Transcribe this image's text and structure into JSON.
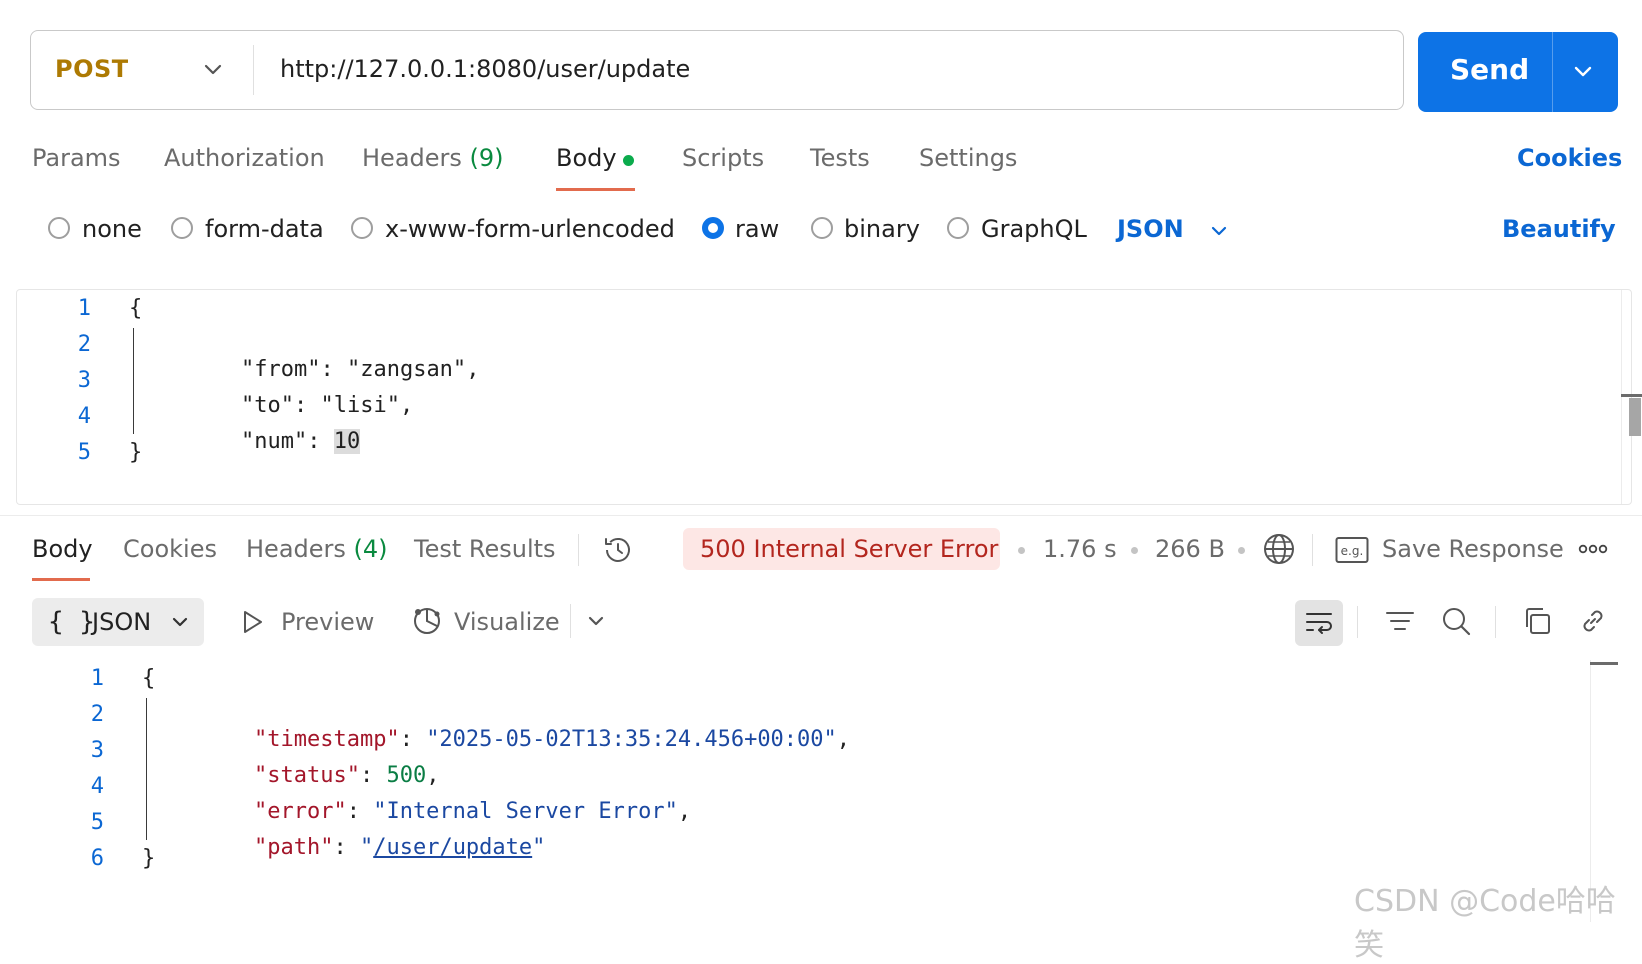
{
  "request": {
    "method": "POST",
    "url": "http://127.0.0.1:8080/user/update",
    "send_label": "Send"
  },
  "request_tabs": [
    {
      "label": "Params"
    },
    {
      "label": "Authorization"
    },
    {
      "label": "Headers",
      "count": "(9)"
    },
    {
      "label": "Body",
      "active": true
    },
    {
      "label": "Scripts"
    },
    {
      "label": "Tests"
    },
    {
      "label": "Settings"
    }
  ],
  "cookies_label": "Cookies",
  "body_types": [
    {
      "label": "none",
      "selected": false
    },
    {
      "label": "form-data",
      "selected": false
    },
    {
      "label": "x-www-form-urlencoded",
      "selected": false
    },
    {
      "label": "raw",
      "selected": true
    },
    {
      "label": "binary",
      "selected": false
    },
    {
      "label": "GraphQL",
      "selected": false
    }
  ],
  "body_format": "JSON",
  "beautify_label": "Beautify",
  "request_body": {
    "line_numbers": [
      "1",
      "2",
      "3",
      "4",
      "5"
    ],
    "open_brace": "{",
    "close_brace": "}",
    "fields": [
      {
        "key": "\"from\"",
        "colon": ": ",
        "value": "\"zangsan\"",
        "trail": ","
      },
      {
        "key": "\"to\"",
        "colon": ": ",
        "value": "\"lisi\"",
        "trail": ","
      },
      {
        "key": "\"num\"",
        "colon": ": ",
        "value": "10",
        "trail": ""
      }
    ]
  },
  "response_tabs": [
    {
      "label": "Body",
      "active": true
    },
    {
      "label": "Cookies"
    },
    {
      "label": "Headers",
      "count": "(4)"
    },
    {
      "label": "Test Results"
    }
  ],
  "response_meta": {
    "status": "500 Internal Server Error",
    "time": "1.76 s",
    "size": "266 B",
    "save_label": "Save Response"
  },
  "response_toolbar": {
    "format_braces": "{ }",
    "format_label": "JSON",
    "preview_label": "Preview",
    "visualize_label": "Visualize"
  },
  "response_body": {
    "line_numbers": [
      "1",
      "2",
      "3",
      "4",
      "5",
      "6"
    ],
    "open_brace": "{",
    "close_brace": "}",
    "fields": [
      {
        "key": "\"timestamp\"",
        "value": "\"2025-05-02T13:35:24.456+00:00\"",
        "trail": ","
      },
      {
        "key": "\"status\"",
        "value": "500",
        "trail": ","
      },
      {
        "key": "\"error\"",
        "value": "\"Internal Server Error\"",
        "trail": ","
      },
      {
        "key": "\"path\"",
        "value_open": "\"",
        "value_link": "/user/update",
        "value_close": "\"",
        "trail": ""
      }
    ]
  },
  "watermark": "CSDN @Code哈哈笑",
  "colors": {
    "accent": "#0d73e6",
    "method": "#ad7a03",
    "error_bg": "#fde7e5",
    "error_text": "#b3261e"
  }
}
